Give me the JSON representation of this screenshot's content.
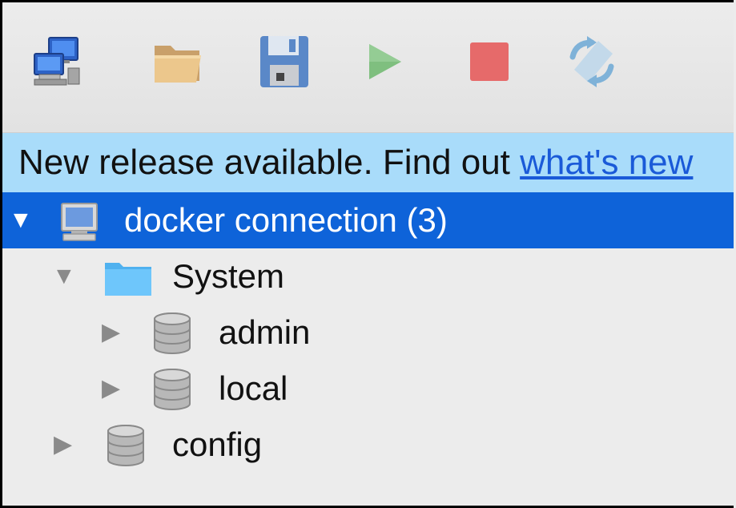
{
  "toolbar": {
    "buttons": [
      {
        "name": "connect",
        "icon": "network-computer-icon"
      },
      {
        "name": "open",
        "icon": "folder-icon"
      },
      {
        "name": "save",
        "icon": "floppy-disk-icon"
      },
      {
        "name": "run",
        "icon": "play-icon"
      },
      {
        "name": "stop",
        "icon": "stop-icon"
      },
      {
        "name": "refresh",
        "icon": "refresh-icon"
      }
    ]
  },
  "banner": {
    "text": "New release available. Find out ",
    "link": "what's new"
  },
  "tree": {
    "connection": {
      "label": "docker connection (3)",
      "icon": "computer-icon",
      "expanded": true
    },
    "system": {
      "label": "System",
      "icon": "folder-icon",
      "expanded": true
    },
    "admin": {
      "label": "admin",
      "icon": "database-icon"
    },
    "local": {
      "label": "local",
      "icon": "database-icon"
    },
    "config": {
      "label": "config",
      "icon": "database-icon"
    }
  },
  "colors": {
    "selection": "#0e63d9",
    "banner": "#a9dcfa",
    "link": "#1a5ad8"
  }
}
